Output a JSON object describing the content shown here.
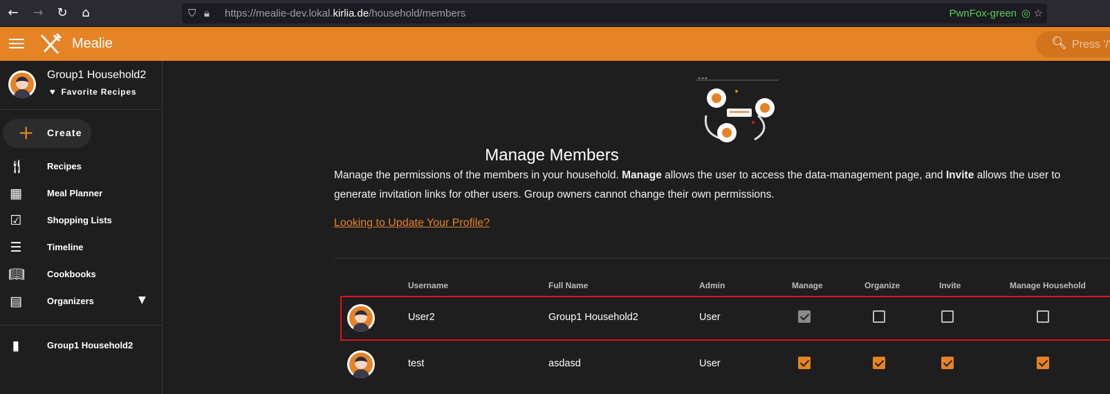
{
  "browser": {
    "url_prefix": "https://mealie-dev.lokal.",
    "url_domain": "kirlia.de",
    "url_path": "/household/members",
    "container_label": "PwnFox-green"
  },
  "app": {
    "title": "Mealie",
    "search_placeholder": "Press '/'"
  },
  "sidebar": {
    "user_name": "Group1 Household2",
    "favorite_label": "Favorite Recipes",
    "create_label": "Create",
    "items": [
      {
        "label": "Recipes",
        "icon": "fork-knife-icon"
      },
      {
        "label": "Meal Planner",
        "icon": "calendar-icon"
      },
      {
        "label": "Shopping Lists",
        "icon": "checklist-icon"
      },
      {
        "label": "Timeline",
        "icon": "timeline-icon"
      },
      {
        "label": "Cookbooks",
        "icon": "book-open-icon"
      },
      {
        "label": "Organizers",
        "icon": "archive-icon"
      }
    ],
    "household_label": "Group1 Household2"
  },
  "main": {
    "title": "Manage Members",
    "desc_part1": "Manage the permissions of the members in your household. ",
    "desc_bold1": "Manage",
    "desc_part2": " allows the user to access the data-management page, and ",
    "desc_bold2": "Invite",
    "desc_part3": " allows the user to generate invitation links for other users. Group owners cannot change their own permissions.",
    "profile_link": "Looking to Update Your Profile?",
    "table": {
      "headers": [
        "Username",
        "Full Name",
        "Admin",
        "Manage",
        "Organize",
        "Invite",
        "Manage Household"
      ],
      "rows": [
        {
          "username": "User2",
          "full_name": "Group1 Household2",
          "admin": "User",
          "manage": true,
          "organize": false,
          "invite": false,
          "manage_household": false,
          "editable": false
        },
        {
          "username": "test",
          "full_name": "asdasd",
          "admin": "User",
          "manage": true,
          "organize": true,
          "invite": true,
          "manage_household": true,
          "editable": true
        }
      ]
    }
  },
  "colors": {
    "accent": "#e58325",
    "highlight": "#e0131c"
  }
}
